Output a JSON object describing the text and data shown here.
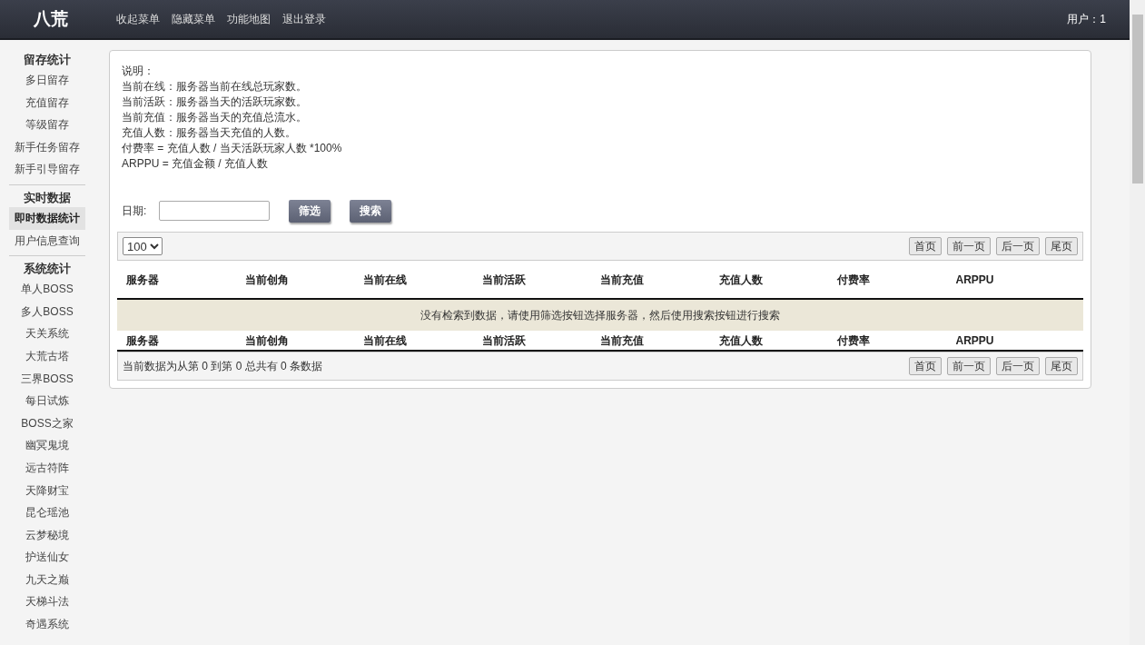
{
  "header": {
    "logo": "八荒",
    "menu": [
      "收起菜单",
      "隐藏菜单",
      "功能地图",
      "退出登录"
    ],
    "user": "用户：1"
  },
  "sidebar": {
    "sections": [
      {
        "title": "留存统计",
        "items": [
          {
            "label": "多日留存",
            "selected": false
          },
          {
            "label": "充值留存",
            "selected": false
          },
          {
            "label": "等级留存",
            "selected": false
          },
          {
            "label": "新手任务留存",
            "selected": false
          },
          {
            "label": "新手引导留存",
            "selected": false
          }
        ]
      },
      {
        "title": "实时数据",
        "items": [
          {
            "label": "即时数据统计",
            "selected": true
          },
          {
            "label": "用户信息查询",
            "selected": false
          }
        ]
      },
      {
        "title": "系统统计",
        "items": [
          {
            "label": "单人BOSS",
            "selected": false
          },
          {
            "label": "多人BOSS",
            "selected": false
          },
          {
            "label": "天关系统",
            "selected": false
          },
          {
            "label": "大荒古塔",
            "selected": false
          },
          {
            "label": "三界BOSS",
            "selected": false
          },
          {
            "label": "每日试炼",
            "selected": false
          },
          {
            "label": "BOSS之家",
            "selected": false
          },
          {
            "label": "幽冥鬼境",
            "selected": false
          },
          {
            "label": "远古符阵",
            "selected": false
          },
          {
            "label": "天降财宝",
            "selected": false
          },
          {
            "label": "昆仑瑶池",
            "selected": false
          },
          {
            "label": "云梦秘境",
            "selected": false
          },
          {
            "label": "护送仙女",
            "selected": false
          },
          {
            "label": "九天之巅",
            "selected": false
          },
          {
            "label": "天梯斗法",
            "selected": false
          },
          {
            "label": "奇遇系统",
            "selected": false
          }
        ]
      }
    ]
  },
  "notes": [
    "说明：",
    "当前在线：服务器当前在线总玩家数。",
    "当前活跃：服务器当天的活跃玩家数。",
    "当前充值：服务器当天的充值总流水。",
    "充值人数：服务器当天充值的人数。",
    "付费率 = 充值人数 / 当天活跃玩家人数 *100%",
    "ARPPU = 充值金额 / 充值人数"
  ],
  "filter": {
    "date_label": "日期:",
    "buttons": [
      "筛选",
      "搜索"
    ]
  },
  "table": {
    "page_size": "100",
    "pager": [
      "首页",
      "前一页",
      "后一页",
      "尾页"
    ],
    "columns": [
      "服务器",
      "当前创角",
      "当前在线",
      "当前活跃",
      "当前充值",
      "充值人数",
      "付费率",
      "ARPPU"
    ],
    "empty_message": "没有检索到数据，请使用筛选按钮选择服务器，然后使用搜索按钮进行搜索",
    "footer_columns": [
      "服务器",
      "当前创角",
      "当前在线",
      "当前活跃",
      "当前充值",
      "充值人数",
      "付费率",
      "ARPPU"
    ],
    "summary": "当前数据为从第 0 到第 0 总共有 0 条数据",
    "footer_pager": [
      "首页",
      "前一页",
      "后一页",
      "尾页"
    ]
  }
}
